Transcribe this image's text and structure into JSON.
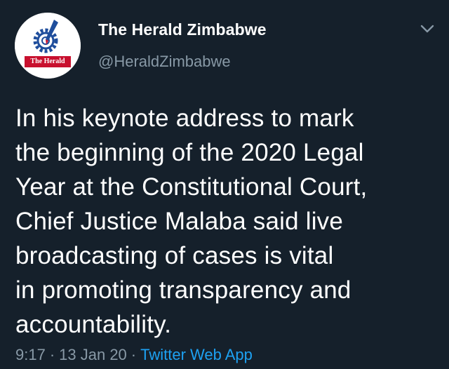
{
  "author": {
    "display_name": "The Herald Zimbabwe",
    "handle": "@HeraldZimbabwe",
    "avatar_logo_text": "The Herald"
  },
  "tweet": {
    "lines": [
      "In his keynote address to mark",
      "the beginning of the 2020 Legal",
      "Year at the Constitutional Court,",
      "Chief Justice Malaba said live",
      "broadcasting of cases is vital",
      "in promoting transparency and",
      "accountability."
    ],
    "time": "9:17",
    "separator": "·",
    "date": "13 Jan 20",
    "source_app": "Twitter Web App"
  },
  "icons": {
    "menu": "chevron-down-icon"
  },
  "colors": {
    "background": "#15202b",
    "text": "#ffffff",
    "secondary": "#8899a6",
    "link": "#1da1f2",
    "brand_red": "#c8102e",
    "brand_blue": "#1f4e9c"
  }
}
